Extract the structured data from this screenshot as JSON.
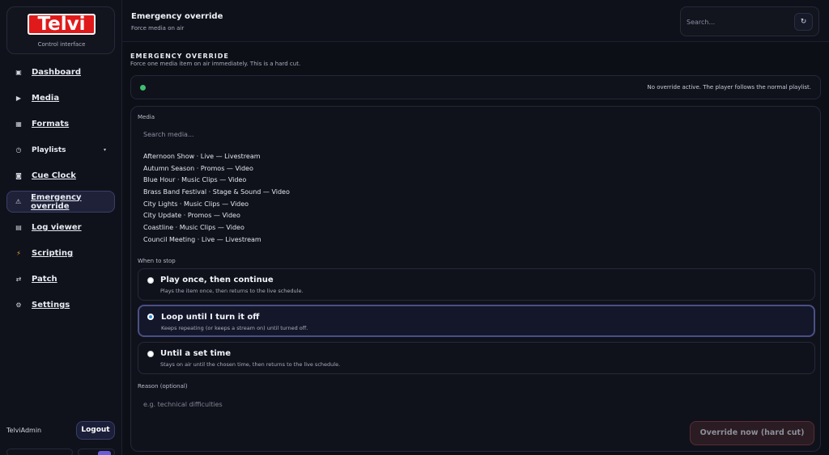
{
  "brand": {
    "logo_text": "Telvi",
    "subtitle": "Control interface"
  },
  "sidebar": {
    "items": [
      {
        "label": "Dashboard",
        "icon": "dashboard-icon",
        "glyph": "▣"
      },
      {
        "label": "Media",
        "icon": "play-icon",
        "glyph": "▶"
      },
      {
        "label": "Formats",
        "icon": "grid-icon",
        "glyph": "▦"
      },
      {
        "label": "Playlists",
        "icon": "clock-icon",
        "glyph": "◷",
        "has_caret": true
      },
      {
        "label": "Cue Clock",
        "icon": "cue-clock-icon",
        "glyph": "◙"
      },
      {
        "label": "Emergency override",
        "icon": "warning-icon",
        "glyph": "⚠",
        "active": true
      },
      {
        "label": "Log viewer",
        "icon": "log-icon",
        "glyph": "▤"
      },
      {
        "label": "Scripting",
        "icon": "scripting-icon",
        "glyph": "⚡"
      },
      {
        "label": "Patch",
        "icon": "patch-icon",
        "glyph": "⇄"
      },
      {
        "label": "Settings",
        "icon": "settings-icon",
        "glyph": "⚙"
      }
    ],
    "caret": "▾"
  },
  "user": {
    "name": "TelviAdmin",
    "logout_label": "Logout"
  },
  "header": {
    "title": "Emergency override",
    "subtitle": "Force media on air",
    "search_placeholder": "Search...",
    "refresh_glyph": "↻"
  },
  "section": {
    "title": "EMERGENCY OVERRIDE",
    "subtitle": "Force one media item on air immediately. This is a hard cut."
  },
  "status": {
    "text": "No override active. The player follows the normal playlist.",
    "color": "#3fbf6f"
  },
  "form": {
    "media_label": "Media",
    "media_search_placeholder": "Search media...",
    "media_items": [
      "Afternoon Show · Live — Livestream",
      "Autumn Season · Promos — Video",
      "Blue Hour · Music Clips — Video",
      "Brass Band Festival · Stage & Sound — Video",
      "City Lights · Music Clips — Video",
      "City Update · Promos — Video",
      "Coastline · Music Clips — Video",
      "Council Meeting · Live — Livestream"
    ],
    "stop_label": "When to stop",
    "options": [
      {
        "title": "Play once, then continue",
        "desc": "Plays the item once, then returns to the live schedule."
      },
      {
        "title": "Loop until I turn it off",
        "desc": "Keeps repeating (or keeps a stream on) until turned off.",
        "selected": true
      },
      {
        "title": "Until a set time",
        "desc": "Stays on air until the chosen time, then returns to the live schedule."
      }
    ],
    "reason_label": "Reason (optional)",
    "reason_placeholder": "e.g. technical difficulties",
    "submit_label": "Override now (hard cut)"
  }
}
